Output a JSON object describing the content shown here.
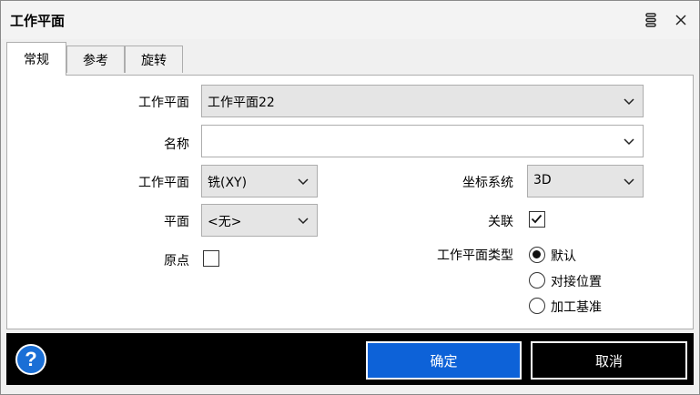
{
  "window": {
    "title": "工作平面"
  },
  "tabs": [
    {
      "label": "常规",
      "active": true
    },
    {
      "label": "参考",
      "active": false
    },
    {
      "label": "旋转",
      "active": false
    }
  ],
  "form": {
    "workplane_label": "工作平面",
    "workplane_value": "工作平面22",
    "name_label": "名称",
    "name_value": "",
    "plane_type_label": "工作平面",
    "plane_type_value": "铣(XY)",
    "coord_label": "坐标系统",
    "coord_value": "3D",
    "plane_label": "平面",
    "plane_value": "<无>",
    "assoc_label": "关联",
    "assoc_checked": true,
    "origin_label": "原点",
    "origin_checked": false,
    "wp_type_label": "工作平面类型",
    "wp_type_options": [
      {
        "label": "默认",
        "selected": true
      },
      {
        "label": "对接位置",
        "selected": false
      },
      {
        "label": "加工基准",
        "selected": false
      }
    ]
  },
  "footer": {
    "help": "?",
    "ok": "确定",
    "cancel": "取消"
  },
  "colors": {
    "accent": "#0d62d8",
    "footer_bg": "#000000"
  }
}
